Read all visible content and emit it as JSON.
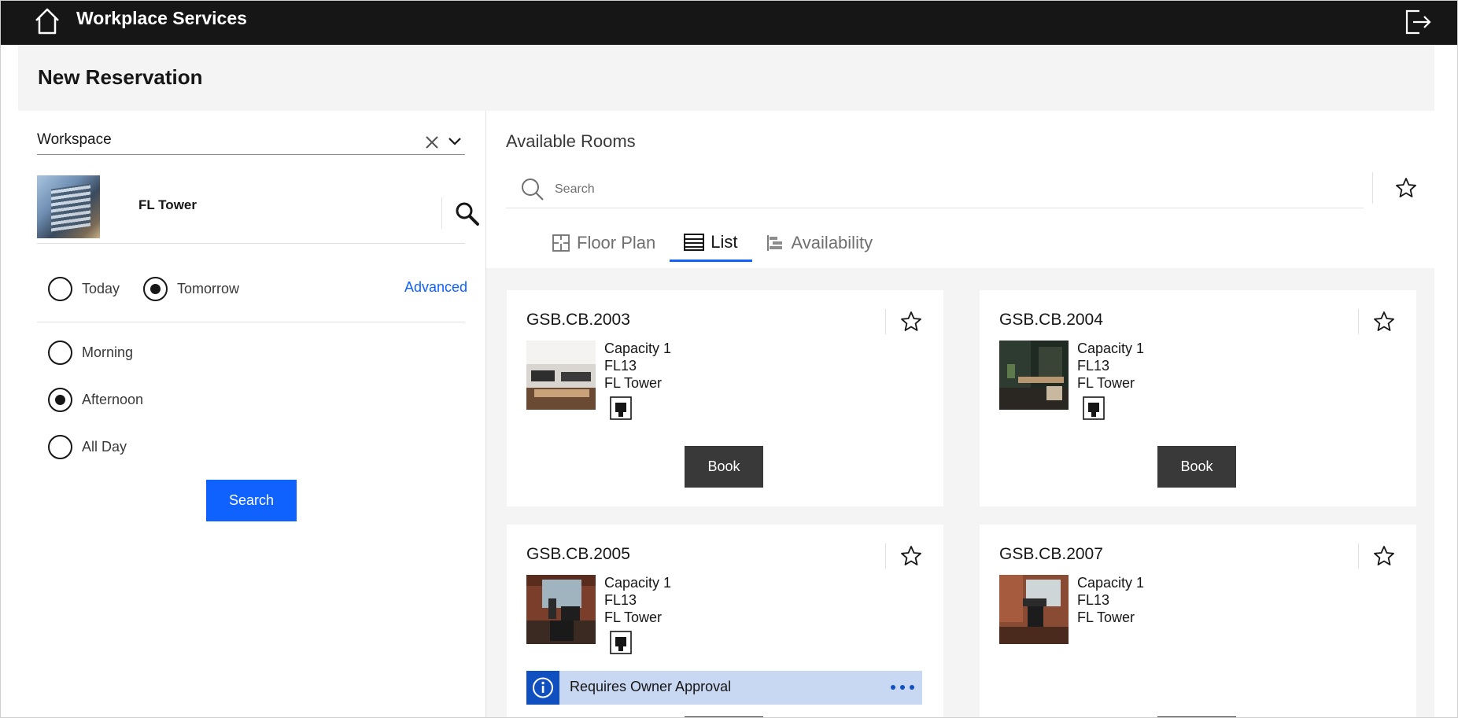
{
  "app": {
    "title": "Workplace Services",
    "home_icon": "home-icon",
    "logout_icon": "logout-icon"
  },
  "page": {
    "title": "New Reservation"
  },
  "filters": {
    "workspace_value": "Workspace",
    "building": {
      "name": "FL Tower"
    },
    "day_options": [
      {
        "label": "Today",
        "selected": false
      },
      {
        "label": "Tomorrow",
        "selected": true
      }
    ],
    "advanced_label": "Advanced",
    "time_options": [
      {
        "label": "Morning",
        "selected": false
      },
      {
        "label": "Afternoon",
        "selected": true
      },
      {
        "label": "All Day",
        "selected": false
      }
    ],
    "search_label": "Search"
  },
  "rooms_panel": {
    "title": "Available Rooms",
    "search_placeholder": "Search",
    "tabs": [
      {
        "label": "Floor Plan",
        "icon": "floor-plan-icon",
        "active": false
      },
      {
        "label": "List",
        "icon": "list-icon",
        "active": true
      },
      {
        "label": "Availability",
        "icon": "availability-icon",
        "active": false
      }
    ]
  },
  "rooms": [
    {
      "name": "GSB.CB.2003",
      "capacity": "Capacity 1",
      "floor": "FL13",
      "building": "FL Tower",
      "book_label": "Book"
    },
    {
      "name": "GSB.CB.2004",
      "capacity": "Capacity 1",
      "floor": "FL13",
      "building": "FL Tower",
      "book_label": "Book"
    },
    {
      "name": "GSB.CB.2005",
      "capacity": "Capacity 1",
      "floor": "FL13",
      "building": "FL Tower",
      "notice": "Requires Owner Approval"
    },
    {
      "name": "GSB.CB.2007",
      "capacity": "Capacity 1",
      "floor": "FL13",
      "building": "FL Tower"
    }
  ],
  "colors": {
    "topbar": "#161616",
    "primary": "#0f62fe",
    "book": "#393939",
    "notice_bg": "#c8d7f2"
  }
}
